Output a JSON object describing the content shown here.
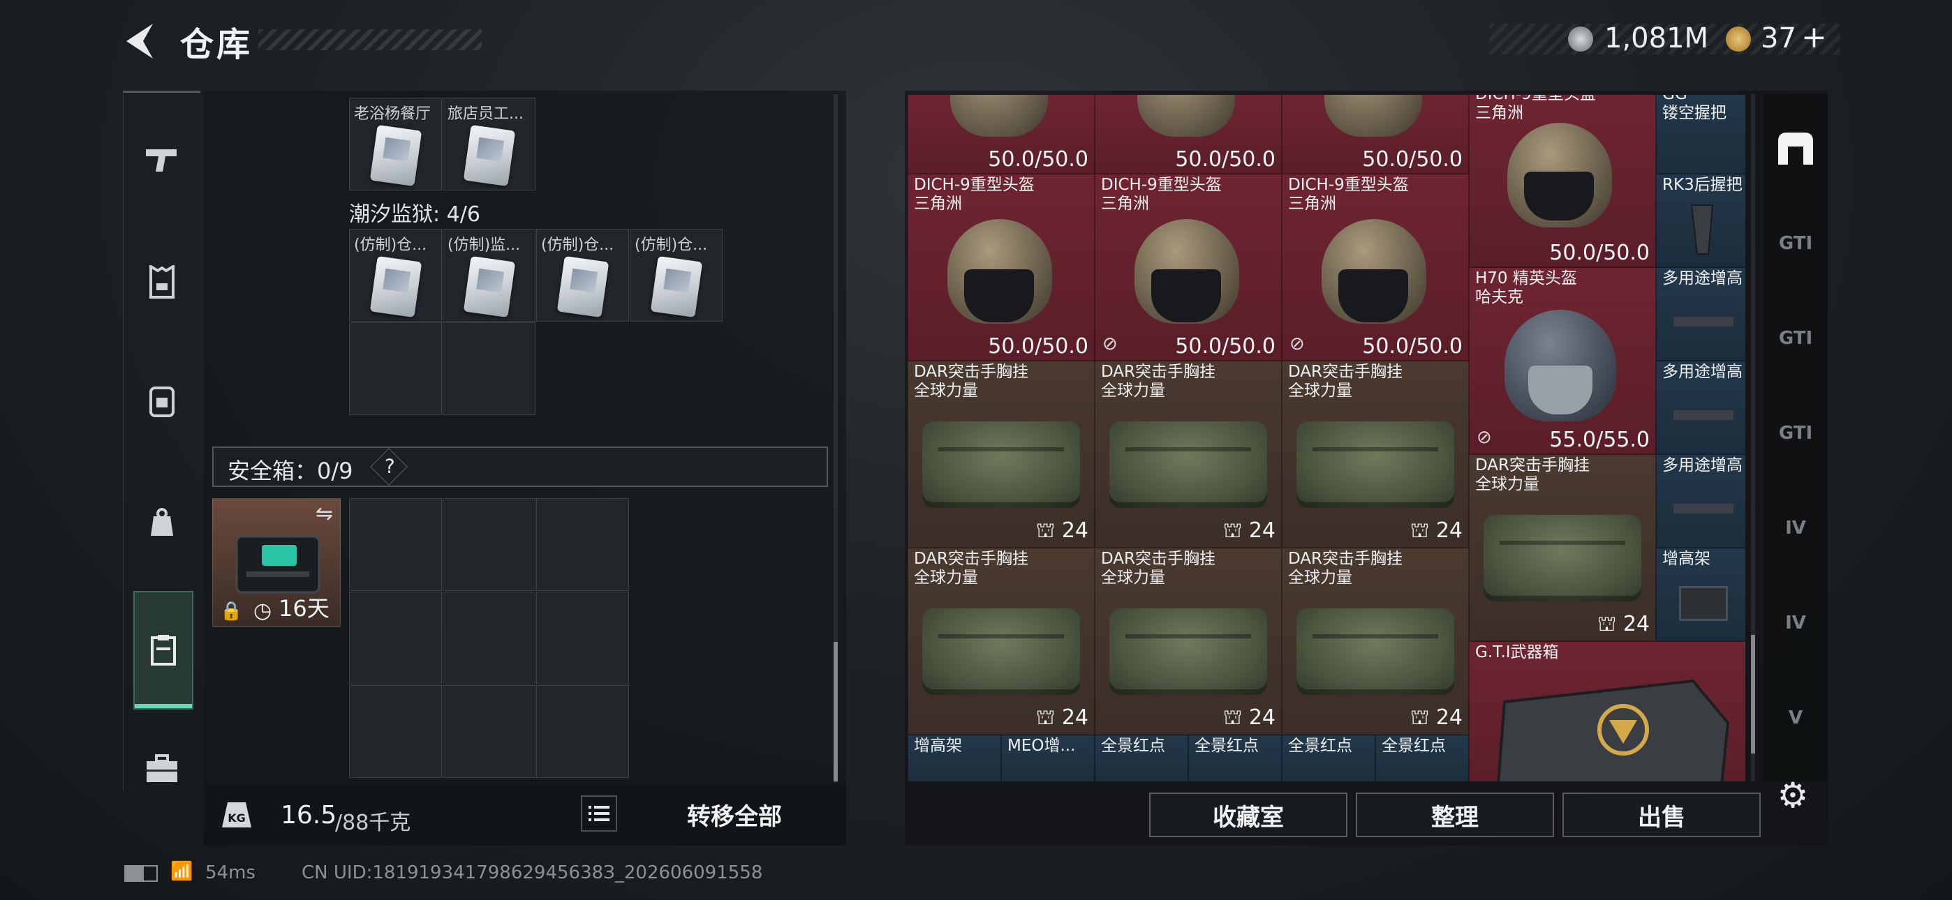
{
  "header": {
    "title": "仓库"
  },
  "currency": [
    {
      "icon": "silver-coin-icon",
      "value": "1,081M"
    },
    {
      "icon": "gold-triangle-icon",
      "value": "37",
      "add": "+"
    }
  ],
  "left_nav": [
    {
      "icon": "pistol-icon"
    },
    {
      "icon": "armor-vest-icon"
    },
    {
      "icon": "backpack-icon"
    },
    {
      "icon": "pouch-icon"
    },
    {
      "icon": "safebox-icon",
      "active": true
    },
    {
      "icon": "toolbox-icon"
    }
  ],
  "left_panel": {
    "top_items": [
      "老浴杨餐厅",
      "旅店员工..."
    ],
    "prison_label": "潮汐监狱: 4/6",
    "prison_items": [
      "(仿制)仓...",
      "(仿制)监...",
      "(仿制)仓...",
      "(仿制)仓..."
    ],
    "safebox_label": "安全箱：0/9",
    "safebox_help": "?",
    "safe_item_time": "16天",
    "weight_value": "16.5",
    "weight_max": "/88千克",
    "transfer_all": "转移全部"
  },
  "stash": {
    "top_row": [
      {
        "name": "",
        "value": "50.0/50.0"
      },
      {
        "name": "",
        "value": "50.0/50.0"
      },
      {
        "name": "",
        "value": "50.0/50.0"
      }
    ],
    "top_right": {
      "name": "DICH-9重型头盔\n三角洲",
      "value": "50.0/50.0"
    },
    "gg_item": {
      "name": "GG\n镂空握把"
    },
    "rk3": {
      "name": "RK3后握把"
    },
    "helmets": [
      {
        "name": "DICH-9重型头盔\n三角洲",
        "value": "50.0/50.0"
      },
      {
        "name": "DICH-9重型头盔\n三角洲",
        "value": "50.0/50.0"
      },
      {
        "name": "DICH-9重型头盔\n三角洲",
        "value": "50.0/50.0"
      }
    ],
    "h70": {
      "name": "H70 精英头盔\n哈夫克",
      "value": "55.0/55.0"
    },
    "multi_1": {
      "name": "多用途增高"
    },
    "multi_2": {
      "name": "多用途增高"
    },
    "multi_3": {
      "name": "多用途增高"
    },
    "riser": {
      "name": "增高架"
    },
    "bags_row1": [
      {
        "name": "DAR突击手胸挂\n全球力量",
        "value": "24"
      },
      {
        "name": "DAR突击手胸挂\n全球力量",
        "value": "24"
      },
      {
        "name": "DAR突击手胸挂\n全球力量",
        "value": "24"
      }
    ],
    "bags_row2": [
      {
        "name": "DAR突击手胸挂\n全球力量",
        "value": "24"
      },
      {
        "name": "DAR突击手胸挂\n全球力量",
        "value": "24"
      },
      {
        "name": "DAR突击手胸挂\n全球力量",
        "value": "24"
      }
    ],
    "bag_right": {
      "name": "DAR突击手胸挂\n全球力量",
      "value": "24"
    },
    "gti_box": {
      "name": "G.T.I武器箱"
    },
    "bottom_row": [
      "增高架",
      "MEO增...",
      "全景红点",
      "全景红点",
      "全景红点",
      "全景红点"
    ]
  },
  "right_nav": [
    "",
    "GTI",
    "GTI",
    "GTI",
    "IV",
    "IV",
    "V"
  ],
  "actions": {
    "collection": "收藏室",
    "organize": "整理",
    "sell": "出售"
  },
  "status": {
    "ping": "54ms",
    "uid": "CN UID:18191934179862945638З_202606091558"
  }
}
